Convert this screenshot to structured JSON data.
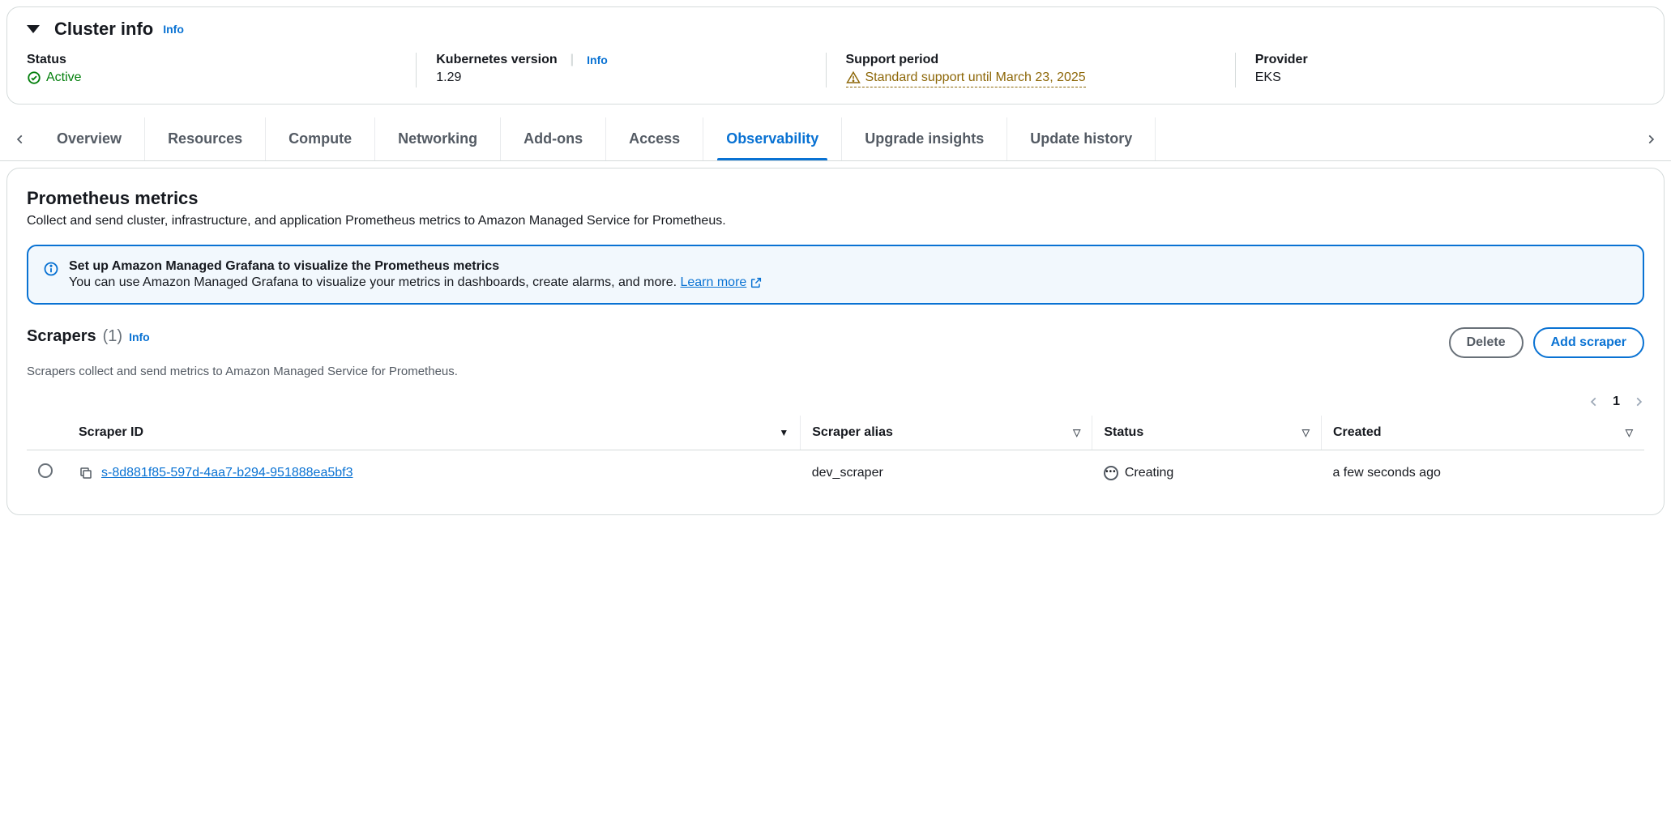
{
  "cluster_info": {
    "heading": "Cluster info",
    "info_link": "Info",
    "status_label": "Status",
    "status_value": "Active",
    "k8s_label": "Kubernetes version",
    "k8s_info": "Info",
    "k8s_value": "1.29",
    "support_label": "Support period",
    "support_value": "Standard support until March 23, 2025",
    "provider_label": "Provider",
    "provider_value": "EKS"
  },
  "tabs": {
    "items": [
      "Overview",
      "Resources",
      "Compute",
      "Networking",
      "Add-ons",
      "Access",
      "Observability",
      "Upgrade insights",
      "Update history"
    ],
    "active_index": 6
  },
  "observability": {
    "title": "Prometheus metrics",
    "subtitle": "Collect and send cluster, infrastructure, and application Prometheus metrics to Amazon Managed Service for Prometheus.",
    "alert_title": "Set up Amazon Managed Grafana to visualize the Prometheus metrics",
    "alert_body": "You can use Amazon Managed Grafana to visualize your metrics in dashboards, create alarms, and more. ",
    "alert_learn": "Learn more"
  },
  "scrapers": {
    "title": "Scrapers",
    "count_text": "(1)",
    "info_link": "Info",
    "subtitle": "Scrapers collect and send metrics to Amazon Managed Service for Prometheus.",
    "delete_btn": "Delete",
    "add_btn": "Add scraper",
    "page_current": "1",
    "columns": {
      "id": "Scraper ID",
      "alias": "Scraper alias",
      "status": "Status",
      "created": "Created"
    },
    "rows": [
      {
        "id": "s-8d881f85-597d-4aa7-b294-951888ea5bf3",
        "alias": "dev_scraper",
        "status": "Creating",
        "created": "a few seconds ago"
      }
    ]
  }
}
